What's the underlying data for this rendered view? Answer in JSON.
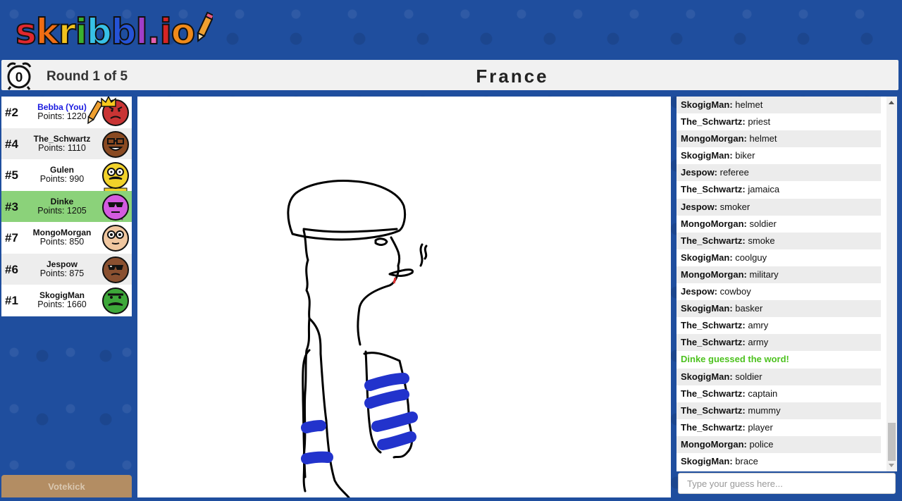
{
  "logo": {
    "letters": [
      "s",
      "k",
      "r",
      "i",
      "b",
      "b",
      "l",
      ".",
      "i",
      "o"
    ],
    "colors": [
      "#e0282e",
      "#f06d13",
      "#f2c21d",
      "#3ab12e",
      "#37c1e6",
      "#2553d6",
      "#a13ec9",
      "#e55fb0",
      "#d62525",
      "#f08a1a"
    ],
    "icon": "pencil-icon"
  },
  "header": {
    "timer": "0",
    "round": "Round 1 of 5",
    "word": "France"
  },
  "players": [
    {
      "rank": "#2",
      "name": "Bebba (You)",
      "points": "Points: 1220",
      "you": true,
      "drawing": true,
      "crown": true,
      "skin": "#c93434",
      "face": "angry"
    },
    {
      "rank": "#4",
      "name": "The_Schwartz",
      "points": "Points: 1110",
      "skin": "#8a4a22",
      "face": "glasses-grin"
    },
    {
      "rank": "#5",
      "name": "Gulen",
      "points": "Points: 990",
      "skin": "#f2d22a",
      "face": "goggles-mustache"
    },
    {
      "rank": "#3",
      "name": "Dinke",
      "points": "Points: 1205",
      "guessed": true,
      "skin": "#d45be0",
      "face": "shades-stripes"
    },
    {
      "rank": "#7",
      "name": "MongoMorgan",
      "points": "Points: 850",
      "skin": "#f0c7a0",
      "face": "goggles"
    },
    {
      "rank": "#6",
      "name": "Jespow",
      "points": "Points: 875",
      "skin": "#8a5030",
      "face": "shades"
    },
    {
      "rank": "#1",
      "name": "SkogigMan",
      "points": "Points: 1660",
      "skin": "#3ea83a",
      "face": "mustache"
    }
  ],
  "votekick": "Votekick",
  "chat": [
    {
      "name": "SkogigMan:",
      "text": " helmet"
    },
    {
      "name": "The_Schwartz:",
      "text": " priest"
    },
    {
      "name": "MongoMorgan:",
      "text": " helmet"
    },
    {
      "name": "SkogigMan:",
      "text": " biker"
    },
    {
      "name": "Jespow:",
      "text": " referee"
    },
    {
      "name": "The_Schwartz:",
      "text": " jamaica"
    },
    {
      "name": "Jespow:",
      "text": " smoker"
    },
    {
      "name": "MongoMorgan:",
      "text": " soldier"
    },
    {
      "name": "The_Schwartz:",
      "text": " smoke"
    },
    {
      "name": "SkogigMan:",
      "text": " coolguy"
    },
    {
      "name": "MongoMorgan:",
      "text": " military"
    },
    {
      "name": "Jespow:",
      "text": " cowboy"
    },
    {
      "name": "SkogigMan:",
      "text": " basker"
    },
    {
      "name": "The_Schwartz:",
      "text": " amry"
    },
    {
      "name": "The_Schwartz:",
      "text": " army"
    },
    {
      "system": "Dinke guessed the word!"
    },
    {
      "name": "SkogigMan:",
      "text": " soldier"
    },
    {
      "name": "The_Schwartz:",
      "text": " captain"
    },
    {
      "name": "The_Schwartz:",
      "text": " mummy"
    },
    {
      "name": "The_Schwartz:",
      "text": " player"
    },
    {
      "name": "MongoMorgan:",
      "text": " police"
    },
    {
      "name": "SkogigMan:",
      "text": " brace"
    }
  ],
  "guess_input": {
    "placeholder": "Type your guess here...",
    "value": ""
  },
  "colors": {
    "background": "#1f4e9e",
    "guessed": "#8bd27a",
    "system_msg": "#4dc21f",
    "you": "#1a1ae0",
    "drawing_blue": "#2233cc"
  }
}
